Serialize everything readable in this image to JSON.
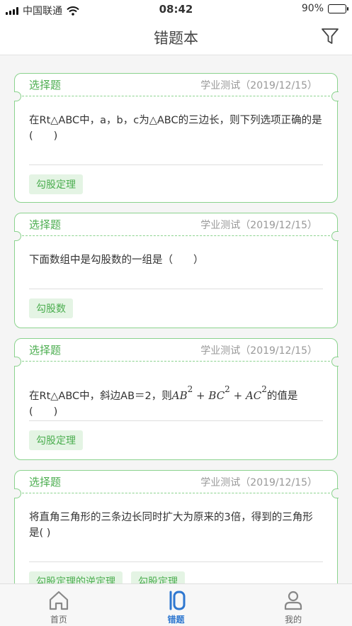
{
  "status_bar": {
    "carrier": "中国联通",
    "time": "08:42",
    "battery": "90%",
    "battery_level": 0.9,
    "signal_icon": "signal-bars-icon",
    "wifi_icon": "wifi-icon"
  },
  "nav": {
    "title": "错题本",
    "filter_icon": "filter-funnel-icon"
  },
  "cards": [
    {
      "type": "选择题",
      "meta": "学业测试（2019/12/15）",
      "question": "在Rt△ABC中，a，b，c为△ABC的三边长，则下列选项正确的是(　　)",
      "tags": [
        "勾股定理"
      ]
    },
    {
      "type": "选择题",
      "meta": "学业测试（2019/12/15）",
      "question": "下面数组中是勾股数的一组是（　　）",
      "tags": [
        "勾股数"
      ]
    },
    {
      "type": "选择题",
      "meta": "学业测试（2019/12/15）",
      "question_before": "在Rt△ABC中，斜边AB＝2，则",
      "formula": {
        "t1": "AB",
        "t2": "BC",
        "t3": "AC",
        "exp": "2",
        "op": "+"
      },
      "question_after": "的值是(　　)",
      "tags": [
        "勾股定理"
      ]
    },
    {
      "type": "选择题",
      "meta": "学业测试（2019/12/15）",
      "question": "将直角三角形的三条边长同时扩大为原来的3倍，得到的三角形是( )",
      "tags": [
        "勾股定理的逆定理",
        "勾股定理"
      ]
    }
  ],
  "tabbar": {
    "tabs": [
      {
        "label": "首页",
        "icon": "home-icon"
      },
      {
        "label": "错题",
        "icon": "wrong-questions-icon",
        "active": true
      },
      {
        "label": "我的",
        "icon": "profile-icon"
      }
    ]
  },
  "colors": {
    "accent_green": "#4cae50",
    "card_border": "#8bd38e",
    "tag_bg": "#e4f4e4",
    "active_tab": "#2e77d0"
  }
}
